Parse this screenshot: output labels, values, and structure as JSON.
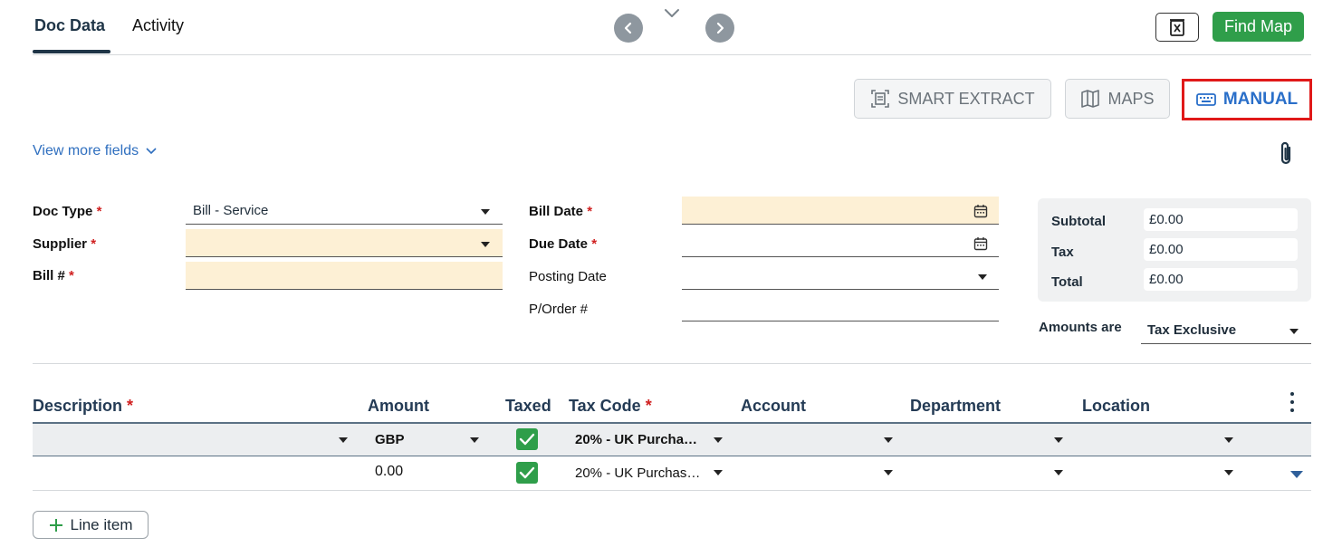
{
  "tabs": [
    {
      "label": "Doc Data",
      "active": true
    },
    {
      "label": "Activity",
      "active": false
    }
  ],
  "header": {
    "find_map_label": "Find Map"
  },
  "toolbar": {
    "smart_extract_label": "SMART EXTRACT",
    "maps_label": "MAPS",
    "manual_label": "MANUAL"
  },
  "view_more": "View more fields",
  "form": {
    "doc_type": {
      "label": "Doc Type",
      "req": "*",
      "value": "Bill - Service"
    },
    "supplier": {
      "label": "Supplier",
      "req": "*",
      "value": ""
    },
    "bill_no": {
      "label": "Bill #",
      "req": "*",
      "value": ""
    },
    "bill_date": {
      "label": "Bill Date",
      "req": "*",
      "value": ""
    },
    "due_date": {
      "label": "Due Date",
      "req": "*",
      "value": ""
    },
    "posting_date": {
      "label": "Posting Date",
      "value": ""
    },
    "po_number": {
      "label": "P/Order #",
      "value": ""
    }
  },
  "totals": {
    "subtotal_label": "Subtotal",
    "subtotal": "£0.00",
    "tax_label": "Tax",
    "tax": "£0.00",
    "total_label": "Total",
    "total": "£0.00",
    "amounts_are_label": "Amounts are",
    "amounts_are": "Tax Exclusive"
  },
  "table": {
    "columns": {
      "description": "Description",
      "amount": "Amount",
      "taxed": "Taxed",
      "tax_code": "Tax Code",
      "account": "Account",
      "department": "Department",
      "location": "Location",
      "req": "*"
    },
    "default_row": {
      "currency": "GBP",
      "taxed": true,
      "tax_code": "20% - UK Purcha…"
    },
    "rows": [
      {
        "description": "",
        "amount": "0.00",
        "taxed": true,
        "tax_code": "20% - UK Purchas…",
        "account": "",
        "department": "",
        "location": ""
      }
    ]
  },
  "add_line_label": "Line item",
  "colors": {
    "accent": "#2f9e4a",
    "link": "#2f6fbf",
    "highlight": "#e01919",
    "required_bg": "#fdf0d5"
  }
}
